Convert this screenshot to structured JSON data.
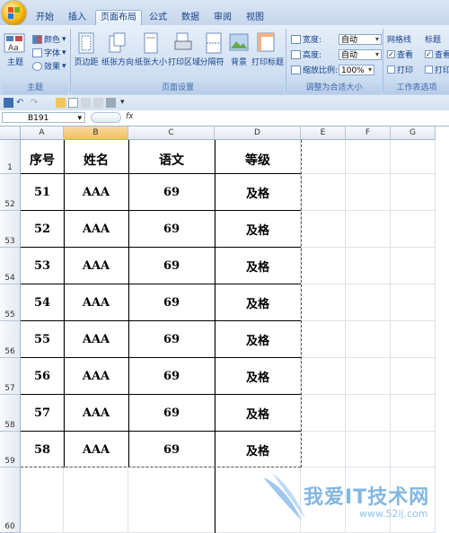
{
  "ribbon_tabs": [
    "开始",
    "插入",
    "页面布局",
    "公式",
    "数据",
    "审阅",
    "视图"
  ],
  "active_tab": "页面布局",
  "groups": {
    "theme": {
      "label": "主题",
      "big": "主题",
      "items": [
        "颜色",
        "字体",
        "效果"
      ]
    },
    "page_setup": {
      "label": "页面设置",
      "buttons": [
        "页边距",
        "纸张方向",
        "纸张大小",
        "打印区域",
        "分隔符",
        "背景",
        "打印标题"
      ]
    },
    "scale": {
      "label": "调整为合适大小",
      "width_label": "宽度:",
      "width_value": "自动",
      "height_label": "高度:",
      "height_value": "自动",
      "zoom_label": "缩放比例:",
      "zoom_value": "100%"
    },
    "sheet_options": {
      "label": "工作表选项",
      "gridlines_label": "网格线",
      "headings_label": "标题",
      "view_label": "查看",
      "print_label": "打印",
      "view_label_2": "查看",
      "print_label_2": "打印"
    }
  },
  "formula_bar": {
    "name_box": "B191",
    "fx": "fx",
    "value": ""
  },
  "columns": [
    "A",
    "B",
    "C",
    "D",
    "E",
    "F",
    "G"
  ],
  "rows": [
    "1",
    "52",
    "53",
    "54",
    "55",
    "56",
    "57",
    "58",
    "59",
    "60"
  ],
  "table": {
    "headers": [
      "序号",
      "姓名",
      "语文",
      "等级"
    ],
    "rows": [
      [
        "51",
        "AAA",
        "69",
        "及格"
      ],
      [
        "52",
        "AAA",
        "69",
        "及格"
      ],
      [
        "53",
        "AAA",
        "69",
        "及格"
      ],
      [
        "54",
        "AAA",
        "69",
        "及格"
      ],
      [
        "55",
        "AAA",
        "69",
        "及格"
      ],
      [
        "56",
        "AAA",
        "69",
        "及格"
      ],
      [
        "57",
        "AAA",
        "69",
        "及格"
      ],
      [
        "58",
        "AAA",
        "69",
        "及格"
      ]
    ]
  },
  "watermark": {
    "title": "我爱IT技术网",
    "url": "www.52ij.com"
  },
  "colors": {
    "ribbon": "#dbe6f4",
    "selected_col": "#f1c15f",
    "grid": "#dde3ea"
  }
}
